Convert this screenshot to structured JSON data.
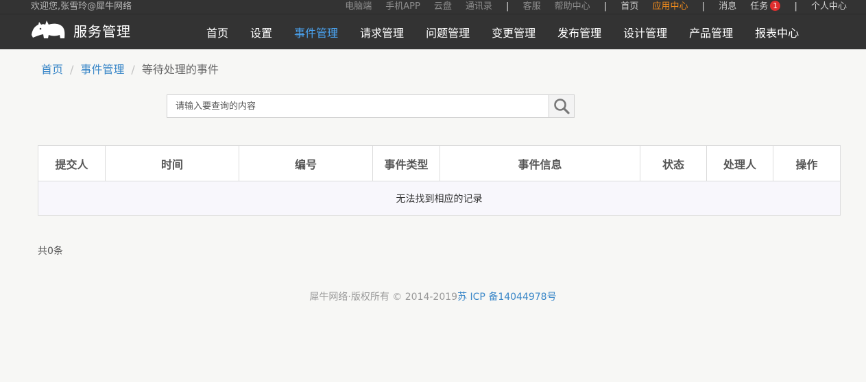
{
  "topbar": {
    "welcome": "欢迎您,张雪玲@犀牛网络",
    "links": {
      "desktop": "电脑端",
      "mobile_app": "手机APP",
      "cloud": "云盘",
      "contacts": "通讯录",
      "service": "客服",
      "help": "帮助中心",
      "home": "首页",
      "app_center": "应用中心",
      "messages": "消息",
      "tasks": "任务",
      "tasks_count": "1",
      "profile": "个人中心"
    },
    "separator": "|"
  },
  "navbar": {
    "logo_text": "服务管理",
    "items": [
      {
        "label": "首页"
      },
      {
        "label": "设置"
      },
      {
        "label": "事件管理"
      },
      {
        "label": "请求管理"
      },
      {
        "label": "问题管理"
      },
      {
        "label": "变更管理"
      },
      {
        "label": "发布管理"
      },
      {
        "label": "设计管理"
      },
      {
        "label": "产品管理"
      },
      {
        "label": "报表中心"
      }
    ],
    "active_index": 2
  },
  "breadcrumb": {
    "home": "首页",
    "section": "事件管理",
    "current": "等待处理的事件",
    "separator": "/"
  },
  "search": {
    "placeholder": "请输入要查询的内容",
    "value": "",
    "icon": "search-icon"
  },
  "table": {
    "columns": [
      "提交人",
      "时间",
      "编号",
      "事件类型",
      "事件信息",
      "状态",
      "处理人",
      "操作"
    ],
    "empty_message": "无法找到相应的记录"
  },
  "pagination": {
    "total_text": "共0条"
  },
  "footer": {
    "copyright": "犀牛网络·版权所有 © 2014-2019",
    "icp": "苏 ICP 备14044978号"
  },
  "colors": {
    "header_bg": "#333333",
    "active_nav": "#4aa3f0",
    "app_center": "#f08b1c",
    "link": "#3a87c8",
    "badge": "#e02f2f"
  }
}
